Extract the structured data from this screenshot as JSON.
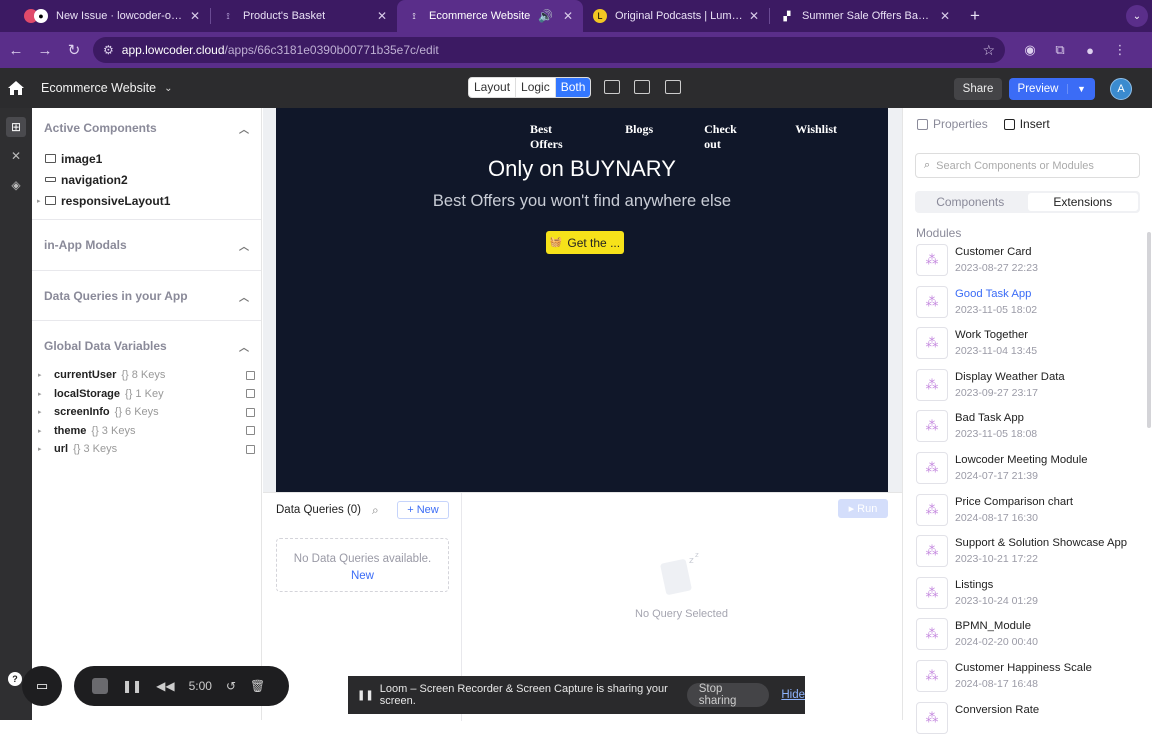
{
  "browser": {
    "tabs": [
      {
        "icon": "github-icon",
        "label": "New Issue · lowcoder-org/low",
        "active": false
      },
      {
        "icon": "lowcoder-icon",
        "label": "Product's Basket",
        "active": false
      },
      {
        "icon": "lowcoder-icon",
        "label": "Ecommerce Website",
        "active": true
      },
      {
        "icon": "luminary-icon",
        "label": "Original Podcasts | Luminary",
        "active": false
      },
      {
        "icon": "banner-icon",
        "label": "Summer Sale Offers Banners",
        "active": false
      }
    ],
    "url_host": "app.lowcoder.cloud",
    "url_path": "/apps/66c3181e0390b00771b35e7c/edit"
  },
  "app": {
    "name": "Ecommerce Website",
    "mode_toggle": [
      "Layout",
      "Logic",
      "Both"
    ],
    "active_mode": "Both",
    "share_label": "Share",
    "preview_label": "Preview",
    "avatar_initial": "A"
  },
  "left_panel": {
    "active_components_title": "Active Components",
    "components": [
      "image1",
      "navigation2",
      "responsiveLayout1"
    ],
    "modals_title": "in-App Modals",
    "queries_title": "Data Queries in your App",
    "globals_title": "Global Data Variables",
    "globals": [
      {
        "name": "currentUser",
        "keys": "{} 8 Keys"
      },
      {
        "name": "localStorage",
        "keys": "{} 1 Key"
      },
      {
        "name": "screenInfo",
        "keys": "{} 6 Keys"
      },
      {
        "name": "theme",
        "keys": "{} 3 Keys"
      },
      {
        "name": "url",
        "keys": "{} 3 Keys"
      }
    ]
  },
  "canvas": {
    "nav_links": [
      "Best Offers",
      "Blogs",
      "Check out",
      "Wishlist"
    ],
    "hero_title": "Only on BUYNARY",
    "hero_subtitle": "Best Offers you won't find anywhere else",
    "cta_label": "Get the ..."
  },
  "data_queries": {
    "title": "Data Queries (0)",
    "new_label": "+ New",
    "empty_text": "No Data Queries available.",
    "empty_link": "New",
    "run_label": "▸ Run",
    "no_query_text": "No Query Selected"
  },
  "right_panel": {
    "tabs": [
      "Properties",
      "Insert"
    ],
    "active_tab": "Insert",
    "search_placeholder": "Search Components or Modules",
    "segments": [
      "Components",
      "Extensions"
    ],
    "active_segment": "Extensions",
    "modules_label": "Modules",
    "modules": [
      {
        "name": "Customer Card",
        "date": "2023-08-27 22:23"
      },
      {
        "name": "Good Task App",
        "date": "2023-11-05 18:02",
        "highlight": true
      },
      {
        "name": "Work Together",
        "date": "2023-11-04 13:45"
      },
      {
        "name": "Display Weather Data",
        "date": "2023-09-27 23:17"
      },
      {
        "name": "Bad Task App",
        "date": "2023-11-05 18:08"
      },
      {
        "name": "Lowcoder Meeting Module",
        "date": "2024-07-17 21:39"
      },
      {
        "name": "Price Comparison chart",
        "date": "2024-08-17 16:30"
      },
      {
        "name": "Support & Solution Showcase App",
        "date": "2023-10-21 17:22"
      },
      {
        "name": "Listings",
        "date": "2023-10-24 01:29"
      },
      {
        "name": "BPMN_Module",
        "date": "2024-02-20 00:40"
      },
      {
        "name": "Customer Happiness Scale",
        "date": "2024-08-17 16:48"
      },
      {
        "name": "Conversion Rate",
        "date": ""
      }
    ]
  },
  "recorder": {
    "time": "5:00"
  },
  "loom_bar": {
    "message": "Loom – Screen Recorder & Screen Capture is sharing your screen.",
    "stop_label": "Stop sharing",
    "hide_label": "Hide"
  }
}
